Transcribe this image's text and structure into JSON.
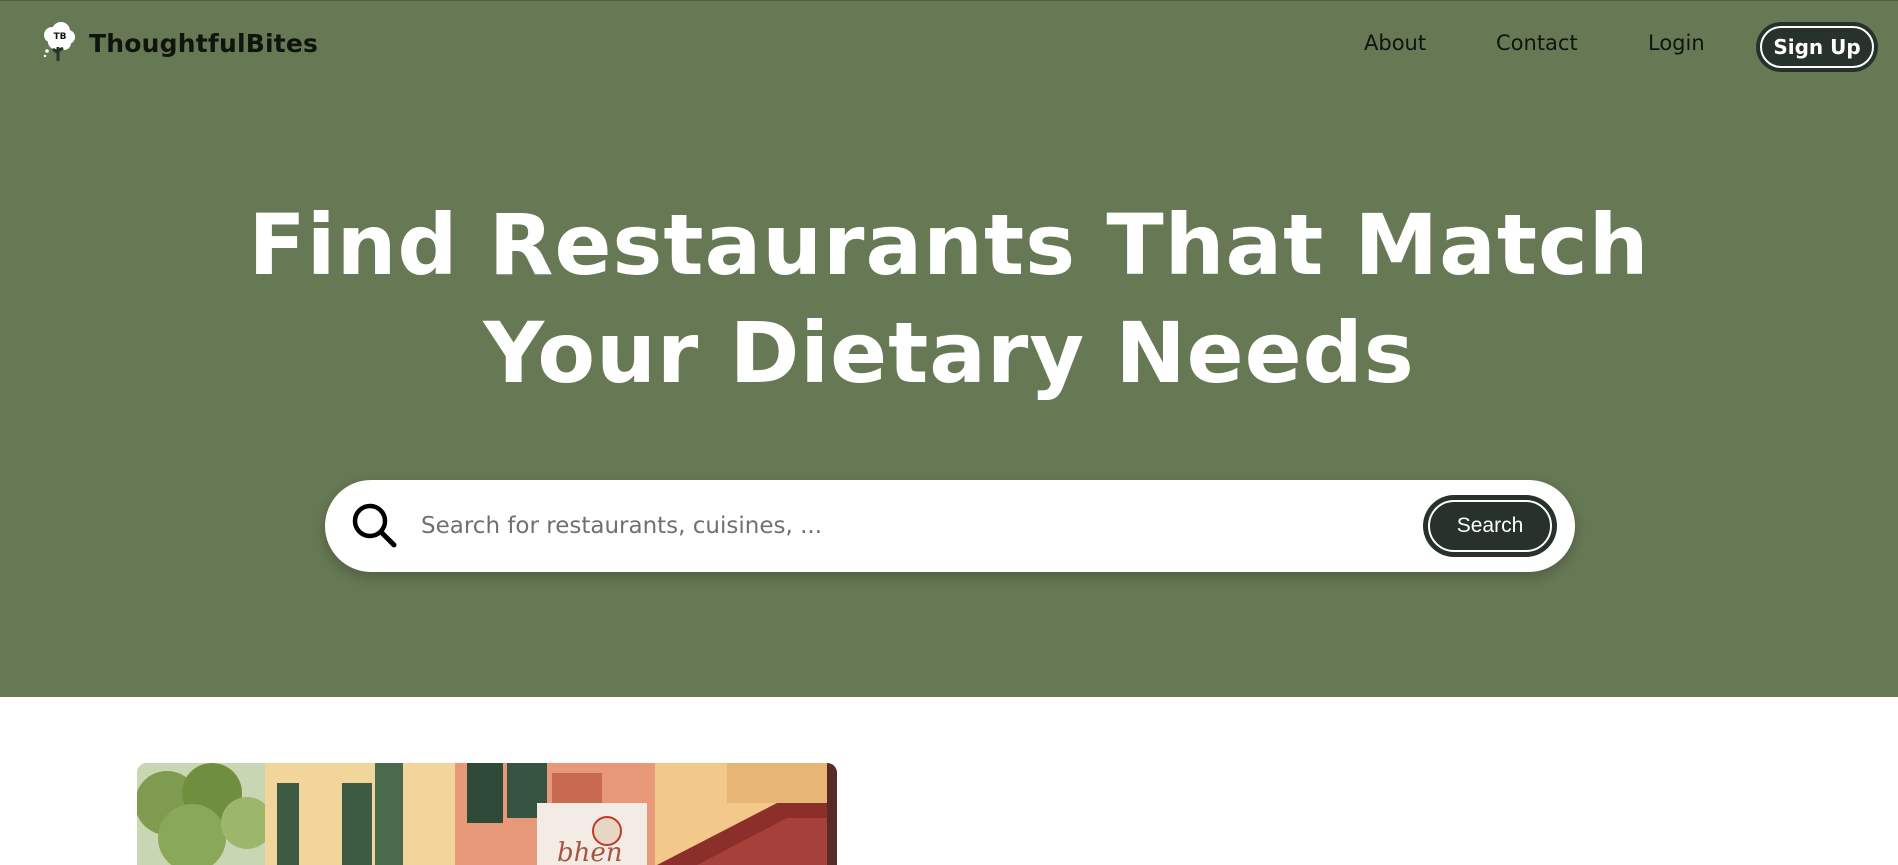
{
  "brand": {
    "name": "ThoughtfulBites",
    "logo_initials": "TB",
    "logo_icon": "tree-icon"
  },
  "nav": {
    "links": [
      {
        "label": "About"
      },
      {
        "label": "Contact"
      },
      {
        "label": "Login"
      }
    ],
    "signup_label": "Sign Up"
  },
  "hero": {
    "headline_line1": "Find Restaurants That Match",
    "headline_line2": "Your Dietary Needs",
    "background_color": "#667854"
  },
  "search": {
    "icon": "search-icon",
    "placeholder": "Search for restaurants, cuisines, ...",
    "value": "",
    "button_label": "Search"
  },
  "colors": {
    "accent_dark": "#27332a",
    "text_dark": "#0f150d"
  }
}
